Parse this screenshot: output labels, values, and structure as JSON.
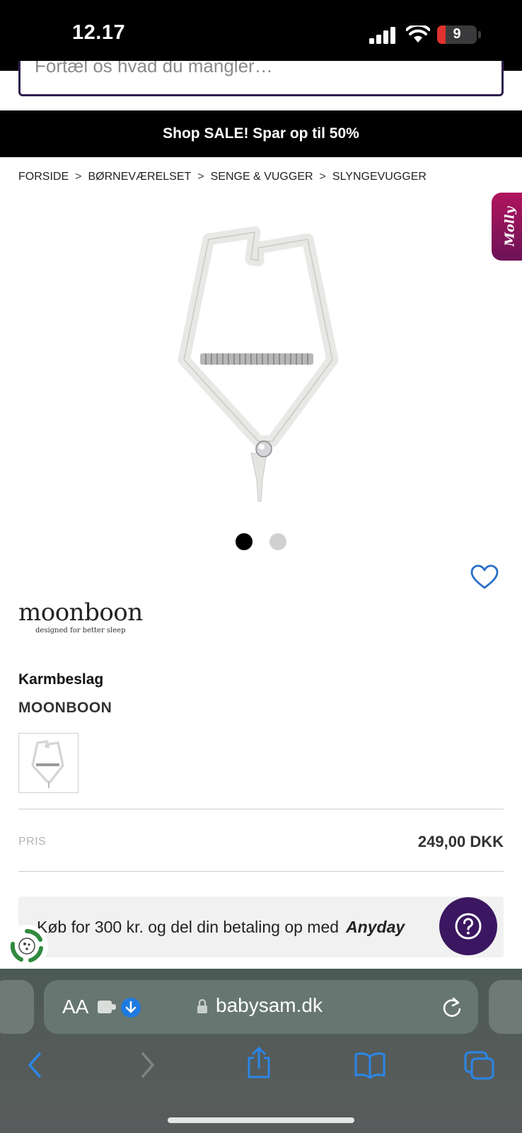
{
  "status_bar": {
    "time": "12.17",
    "battery_level": "9",
    "icons": [
      "signal-icon",
      "wifi-icon",
      "battery-icon"
    ]
  },
  "search": {
    "placeholder": "Fortæl os hvad du mangler…"
  },
  "promo": {
    "text": "Shop SALE! Spar op til 50%"
  },
  "breadcrumb": {
    "separator": ">",
    "items": [
      "FORSIDE",
      "BØRNEVÆRELSET",
      "SENGE & VUGGER",
      "SLYNGEVUGGER"
    ]
  },
  "molly": {
    "label": "Molly"
  },
  "gallery": {
    "image_count": 2,
    "active_index": 0
  },
  "brand_logo": {
    "name": "moonboon",
    "tagline": "designed for better sleep"
  },
  "product": {
    "title": "Karmbeslag",
    "brand": "MOONBOON",
    "price_label": "PRIS",
    "price": "249,00 DKK"
  },
  "anyday": {
    "text": "Køb for 300 kr. og del din betaling op med",
    "logo": "Anyday"
  },
  "browser": {
    "aa_label": "AA",
    "url": "babysam.dk"
  },
  "colors": {
    "search_border": "#2d1f4f",
    "help_button": "#3a1760",
    "molly_tab": "#b0155e",
    "favorite_outline": "#2a6fc9",
    "safari_blue": "#1f7ae0"
  }
}
